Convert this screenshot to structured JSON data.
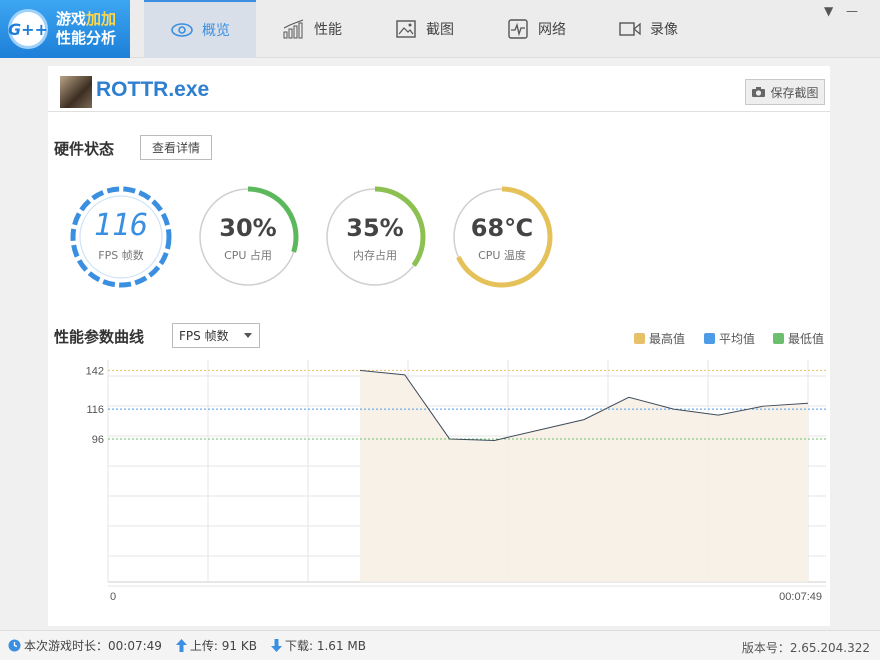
{
  "logo": {
    "badge": "G++",
    "line1_a": "游戏",
    "line1_b": "加加",
    "line2": "性能分析"
  },
  "tabs": [
    {
      "label": "概览",
      "icon": "eye-icon",
      "active": true
    },
    {
      "label": "性能",
      "icon": "bar-chart-icon",
      "active": false
    },
    {
      "label": "截图",
      "icon": "image-icon",
      "active": false
    },
    {
      "label": "网络",
      "icon": "pulse-icon",
      "active": false
    },
    {
      "label": "录像",
      "icon": "video-camera-icon",
      "active": false
    }
  ],
  "window": {
    "dropdown": "▼",
    "minimize": "—"
  },
  "game": {
    "title": "ROTTR.exe",
    "save_label": "保存截图"
  },
  "hardware": {
    "title": "硬件状态",
    "detail_label": "查看详情",
    "gauges": [
      {
        "value": "116",
        "label": "FPS 帧数",
        "fraction": 1.0,
        "color": "#3b8fe0"
      },
      {
        "value": "30%",
        "label": "CPU 占用",
        "fraction": 0.3,
        "color": "#5cb85c"
      },
      {
        "value": "35%",
        "label": "内存占用",
        "fraction": 0.35,
        "color": "#8cc152"
      },
      {
        "value": "68℃",
        "label": "CPU 温度",
        "fraction": 0.68,
        "color": "#e5c15a"
      }
    ]
  },
  "curve": {
    "title": "性能参数曲线",
    "select_value": "FPS 帧数",
    "legend": [
      {
        "label": "最高值",
        "color": "#e8c06a"
      },
      {
        "label": "平均值",
        "color": "#4e9be6"
      },
      {
        "label": "最低值",
        "color": "#6cbf6c"
      }
    ]
  },
  "chart_data": {
    "type": "line",
    "reference_lines": {
      "max": 142,
      "avg": 116,
      "min": 96
    },
    "y_ticks": [
      "142",
      "116",
      "96"
    ],
    "x_labels": [
      "0",
      "00:07:49"
    ],
    "ylim": [
      0,
      149
    ],
    "values": [
      142,
      139,
      96,
      95,
      102,
      109,
      124,
      116,
      112,
      118,
      120
    ],
    "grid": true
  },
  "footer": {
    "duration_label": "本次游戏时长：",
    "duration": "00:07:49",
    "upload_label": "上传:",
    "upload": "91 KB",
    "download_label": "下载:",
    "download": "1.61 MB",
    "version_label": "版本号：",
    "version": "2.65.204.322"
  }
}
